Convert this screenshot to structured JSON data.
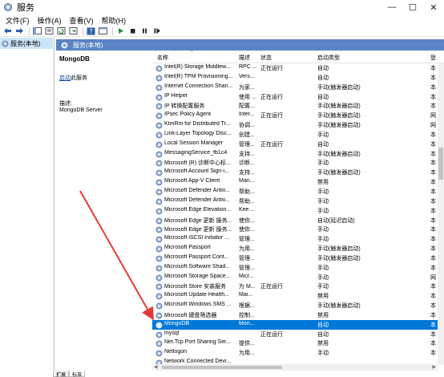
{
  "window": {
    "title": "服务",
    "minimize": "—",
    "maximize": "☐",
    "close": "✕"
  },
  "menu": [
    "文件(F)",
    "操作(A)",
    "查看(V)",
    "帮助(H)"
  ],
  "tree": {
    "item": "服务(本地)"
  },
  "content_header": "服务(本地)",
  "details": {
    "service_name": "MongoDB",
    "action_link": "启动",
    "action_suffix": "此服务",
    "desc_label": "描述:",
    "desc_text": "MongoDB Server"
  },
  "columns": {
    "name": "名称",
    "desc": "描述",
    "state": "状态",
    "start": "启动类型",
    "logon": "登"
  },
  "rows": [
    {
      "name": "Intel(R) Storage Middlew...",
      "desc": "RPC ...",
      "state": "正在运行",
      "start": "自动",
      "logon": "本"
    },
    {
      "name": "Intel(R) TPM Provisioning...",
      "desc": "Vers...",
      "state": "",
      "start": "自动",
      "logon": "本"
    },
    {
      "name": "Internet Connection Shari...",
      "desc": "为家...",
      "state": "",
      "start": "手动(触发器启动)",
      "logon": "本"
    },
    {
      "name": "IP Helper",
      "desc": "使用 ...",
      "state": "正在运行",
      "start": "自动",
      "logon": "本"
    },
    {
      "name": "IP 转换配置服务",
      "desc": "配置...",
      "state": "",
      "start": "手动(触发器启动)",
      "logon": "本"
    },
    {
      "name": "IPsec Policy Agent",
      "desc": "Inter...",
      "state": "正在运行",
      "start": "手动(触发器启动)",
      "logon": "网"
    },
    {
      "name": "KtmRm for Distributed Tr...",
      "desc": "协调...",
      "state": "",
      "start": "手动(触发器启动)",
      "logon": "网"
    },
    {
      "name": "Link-Layer Topology Disc...",
      "desc": "创建...",
      "state": "",
      "start": "手动",
      "logon": "本"
    },
    {
      "name": "Local Session Manager",
      "desc": "管理...",
      "state": "正在运行",
      "start": "自动",
      "logon": "本"
    },
    {
      "name": "MessagingService_fb1c4",
      "desc": "支持...",
      "state": "",
      "start": "手动(触发器启动)",
      "logon": "本"
    },
    {
      "name": "Microsoft (R) 诊断中心标...",
      "desc": "诊断...",
      "state": "",
      "start": "手动",
      "logon": "本"
    },
    {
      "name": "Microsoft Account Sign-i...",
      "desc": "支持...",
      "state": "",
      "start": "手动(触发器启动)",
      "logon": "本"
    },
    {
      "name": "Microsoft App-V Client",
      "desc": "Man...",
      "state": "",
      "start": "禁用",
      "logon": "本"
    },
    {
      "name": "Microsoft Defender Antiv...",
      "desc": "帮助...",
      "state": "",
      "start": "手动",
      "logon": "本"
    },
    {
      "name": "Microsoft Defender Antiv...",
      "desc": "帮助...",
      "state": "",
      "start": "手动",
      "logon": "本"
    },
    {
      "name": "Microsoft Edge Elevation...",
      "desc": "Kee...",
      "state": "",
      "start": "手动",
      "logon": "本"
    },
    {
      "name": "Microsoft Edge 更新 服务...",
      "desc": "使你...",
      "state": "",
      "start": "自动(延迟启动)",
      "logon": "本"
    },
    {
      "name": "Microsoft Edge 更新 服务...",
      "desc": "使你...",
      "state": "",
      "start": "手动",
      "logon": "本"
    },
    {
      "name": "Microsoft iSCSI Initiator ...",
      "desc": "管理...",
      "state": "",
      "start": "手动",
      "logon": "本"
    },
    {
      "name": "Microsoft Passport",
      "desc": "为用...",
      "state": "",
      "start": "手动(触发器启动)",
      "logon": "本"
    },
    {
      "name": "Microsoft Passport Cont...",
      "desc": "管理...",
      "state": "",
      "start": "手动(触发器启动)",
      "logon": "本"
    },
    {
      "name": "Microsoft Software Shad...",
      "desc": "管理...",
      "state": "",
      "start": "手动",
      "logon": "本"
    },
    {
      "name": "Microsoft Storage Space...",
      "desc": "Micr...",
      "state": "",
      "start": "手动",
      "logon": "网"
    },
    {
      "name": "Microsoft Store 安装服务",
      "desc": "为 M...",
      "state": "正在运行",
      "start": "手动",
      "logon": "本"
    },
    {
      "name": "Microsoft Update Health...",
      "desc": "Mai...",
      "state": "",
      "start": "禁用",
      "logon": "本"
    },
    {
      "name": "Microsoft Windows SMS ...",
      "desc": "根据...",
      "state": "",
      "start": "手动(触发器启动)",
      "logon": "本"
    },
    {
      "name": "Microsoft 键盘筛选器",
      "desc": "控制...",
      "state": "",
      "start": "禁用",
      "logon": "本"
    },
    {
      "name": "MongoDB",
      "desc": "Mon...",
      "state": "",
      "start": "自动",
      "logon": "本",
      "selected": true
    },
    {
      "name": "mysql",
      "desc": "",
      "state": "正在运行",
      "start": "自动",
      "logon": "本"
    },
    {
      "name": "Net.Tcp Port Sharing Ser...",
      "desc": "提供...",
      "state": "",
      "start": "禁用",
      "logon": "本"
    },
    {
      "name": "Netlogon",
      "desc": "为用...",
      "state": "",
      "start": "手动",
      "logon": "本"
    },
    {
      "name": "Network Connected Devi...",
      "desc": "",
      "state": "",
      "start": "",
      "logon": ""
    }
  ],
  "tabs": [
    "扩展",
    "标准"
  ],
  "colors": {
    "accent": "#0078d7",
    "header": "#5b84c4",
    "arrow": "#e53935"
  },
  "icons": {
    "service": "gear-icon"
  }
}
